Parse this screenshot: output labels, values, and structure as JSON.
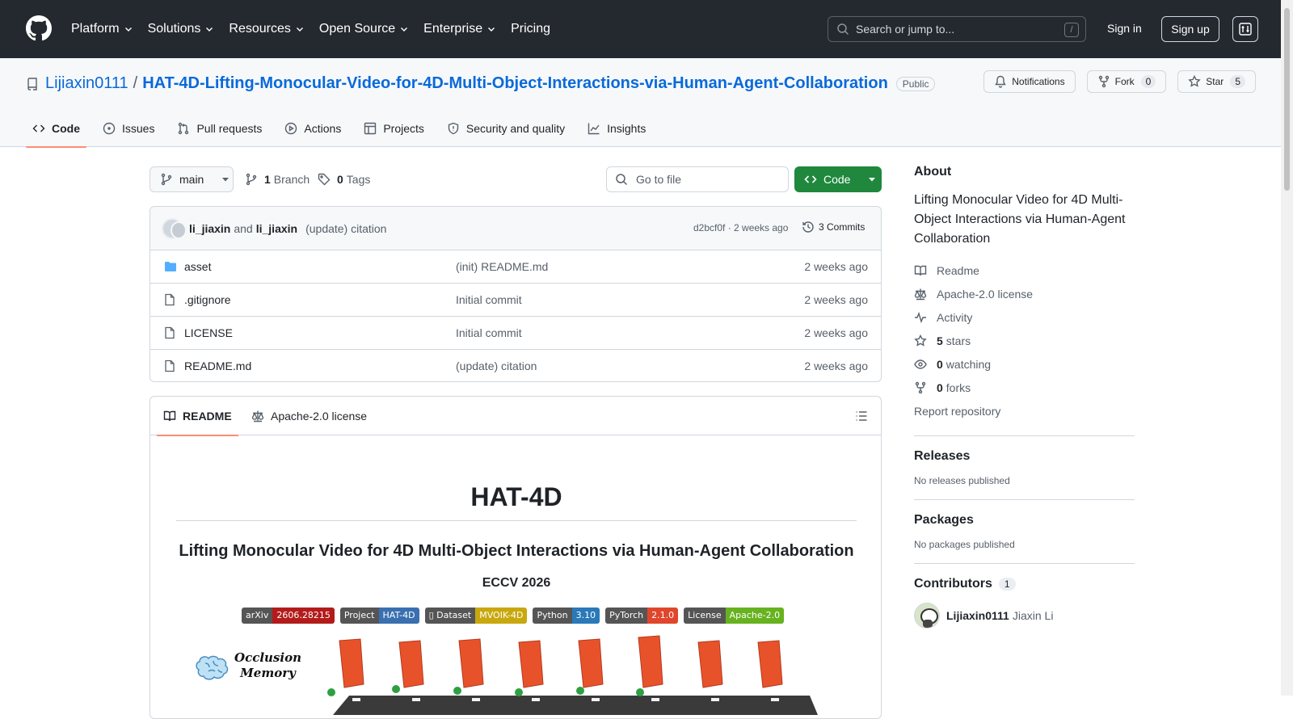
{
  "header": {
    "nav": [
      {
        "label": "Platform",
        "dropdown": true
      },
      {
        "label": "Solutions",
        "dropdown": true
      },
      {
        "label": "Resources",
        "dropdown": true
      },
      {
        "label": "Open Source",
        "dropdown": true
      },
      {
        "label": "Enterprise",
        "dropdown": true
      },
      {
        "label": "Pricing",
        "dropdown": false
      }
    ],
    "search_placeholder": "Search or jump to...",
    "search_shortcut": "/",
    "sign_in": "Sign in",
    "sign_up": "Sign up"
  },
  "repo": {
    "owner": "Lijiaxin0111",
    "separator": "/",
    "name": "HAT-4D-Lifting-Monocular-Video-for-4D-Multi-Object-Interactions-via-Human-Agent-Collaboration",
    "visibility": "Public",
    "actions": {
      "notifications": "Notifications",
      "fork": "Fork",
      "fork_count": "0",
      "star": "Star",
      "star_count": "5"
    },
    "tabs": [
      {
        "label": "Code",
        "icon": "code-icon",
        "active": true
      },
      {
        "label": "Issues",
        "icon": "issue-icon",
        "active": false
      },
      {
        "label": "Pull requests",
        "icon": "pull-request-icon",
        "active": false
      },
      {
        "label": "Actions",
        "icon": "play-icon",
        "active": false
      },
      {
        "label": "Projects",
        "icon": "table-icon",
        "active": false
      },
      {
        "label": "Security and quality",
        "icon": "shield-icon",
        "active": false
      },
      {
        "label": "Insights",
        "icon": "graph-icon",
        "active": false
      }
    ]
  },
  "toolbar": {
    "branch": "main",
    "branch_count": "1",
    "branch_label": "Branch",
    "tag_count": "0",
    "tag_label": "Tags",
    "goto_placeholder": "Go to file",
    "code_button": "Code"
  },
  "commit": {
    "author1": "li_jiaxin",
    "and": "and",
    "author2": "li_jiaxin",
    "message": "(update) citation",
    "hash_time": "d2bcf0f · 2 weeks ago",
    "commits": "3 Commits"
  },
  "files": [
    {
      "name": "asset",
      "type": "folder",
      "message": "(init) README.md",
      "date": "2 weeks ago"
    },
    {
      "name": ".gitignore",
      "type": "file",
      "message": "Initial commit",
      "date": "2 weeks ago"
    },
    {
      "name": "LICENSE",
      "type": "file",
      "message": "Initial commit",
      "date": "2 weeks ago"
    },
    {
      "name": "README.md",
      "type": "file",
      "message": "(update) citation",
      "date": "2 weeks ago"
    }
  ],
  "readme": {
    "tab_readme": "README",
    "tab_license": "Apache-2.0 license",
    "h1": "HAT-4D",
    "h2": "Lifting Monocular Video for 4D Multi-Object Interactions via Human-Agent Collaboration",
    "venue": "ECCV 2026",
    "badges": [
      {
        "left": "arXiv",
        "right": "2606.28215",
        "color": "#b31b1b"
      },
      {
        "left": "Project",
        "right": "HAT-4D",
        "color": "#3a6fb0"
      },
      {
        "left": "▯ Dataset",
        "right": "MVOIK-4D",
        "color": "#c8a80e"
      },
      {
        "left": "Python",
        "right": "3.10",
        "color": "#2a79b8"
      },
      {
        "left": "PyTorch",
        "right": "2.1.0",
        "color": "#e0462b"
      },
      {
        "left": "License",
        "right": "Apache-2.0",
        "color": "#67b21f"
      }
    ],
    "hero_label_line1": "Occlusion",
    "hero_label_line2": "Memory"
  },
  "sidebar": {
    "about_title": "About",
    "description": "Lifting Monocular Video for 4D Multi-Object Interactions via Human-Agent Collaboration",
    "links": [
      {
        "label": "Readme",
        "bold": "",
        "icon": "book-icon"
      },
      {
        "label": "Apache-2.0 license",
        "bold": "",
        "icon": "law-icon"
      },
      {
        "label": "Activity",
        "bold": "",
        "icon": "pulse-icon"
      },
      {
        "label": "stars",
        "bold": "5",
        "icon": "star-icon"
      },
      {
        "label": "watching",
        "bold": "0",
        "icon": "eye-icon"
      },
      {
        "label": "forks",
        "bold": "0",
        "icon": "fork-icon"
      }
    ],
    "report": "Report repository",
    "releases_title": "Releases",
    "releases_text": "No releases published",
    "packages_title": "Packages",
    "packages_text": "No packages published",
    "contributors_title": "Contributors",
    "contributors_count": "1",
    "contributor_login": "Lijiaxin0111",
    "contributor_name": "Jiaxin Li"
  },
  "colors": {
    "header_bg": "#24292f",
    "link": "#0969da",
    "primary_button": "#1f883d",
    "active_tab_underline": "#fd8c73"
  }
}
